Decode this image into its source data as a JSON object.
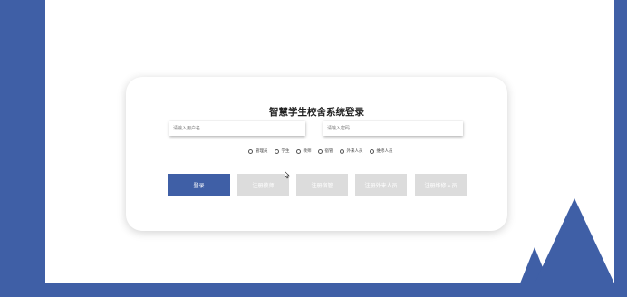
{
  "login": {
    "title": "智慧学生校舍系统登录",
    "username_placeholder": "请输入用户名",
    "password_placeholder": "请输入密码",
    "roles": [
      "管理员",
      "学生",
      "教师",
      "宿管",
      "外来人员",
      "维修人员"
    ],
    "login_button": "登录",
    "register_buttons": [
      "注册教师",
      "注册宿管",
      "注册外来人员",
      "注册维修人员"
    ]
  },
  "colors": {
    "brand": "#3f5fa6",
    "disabled_button": "#dcdcdc"
  }
}
